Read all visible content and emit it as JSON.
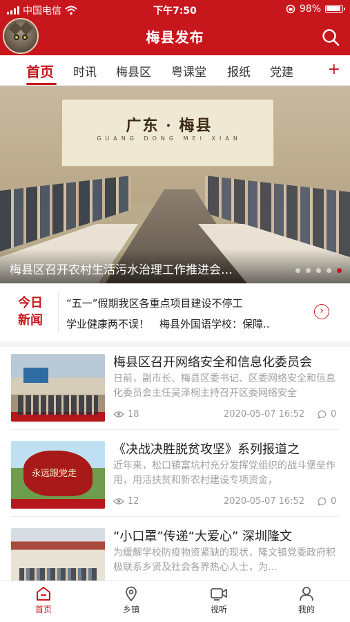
{
  "status_bar": {
    "carrier": "中国电信",
    "time": "下午7:50",
    "battery": "98%"
  },
  "header": {
    "title": "梅县发布"
  },
  "tabs": [
    "首页",
    "时讯",
    "梅县区",
    "粤课堂",
    "报纸",
    "党建"
  ],
  "tab_add": "+",
  "banner": {
    "caption": "梅县区召开农村生活污水治理工作推进会…",
    "sign_text": "广东 · 梅县",
    "sign_sub": "GUANG DONG  MEI XIAN"
  },
  "today_news": {
    "label_line1": "今日",
    "label_line2": "新闻",
    "items": [
      "“五一”假期我区各重点项目建设不停工",
      "学业健康两不误！　梅县外国语学校：保障.."
    ]
  },
  "articles": [
    {
      "title": "梅县区召开网络安全和信息化委员会",
      "summary": "日前，副市长、梅县区委书记、区委网络安全和信息化委员会主任吴泽桐主持召开区委网络安全",
      "views": "18",
      "date": "2020-05-07 16:52",
      "comments": "0"
    },
    {
      "title": "《决战决胜脱贫攻坚》系列报道之",
      "summary": "近年来，松口镇富坑村充分发挥党组织的战斗堡垒作用，用活扶贫和新农村建设专项资金，",
      "views": "12",
      "date": "2020-05-07 16:52",
      "comments": "0",
      "thumb_text": "永远跟党走"
    },
    {
      "title": "“小口罩”传递“大爱心” 深圳隆文",
      "summary": "为缓解学校防疫物资紧缺的现状，隆文镇党委政府积极联系乡贤及社会各界热心人士，为…"
    }
  ],
  "bottom_nav": [
    {
      "label": "首页",
      "icon": "home-icon",
      "active": true
    },
    {
      "label": "乡镇",
      "icon": "location-pin-icon",
      "active": false
    },
    {
      "label": "视听",
      "icon": "video-camera-icon",
      "active": false
    },
    {
      "label": "我的",
      "icon": "person-icon",
      "active": false
    }
  ],
  "colors": {
    "brand": "#c8161d",
    "muted": "#a0a0a0"
  }
}
